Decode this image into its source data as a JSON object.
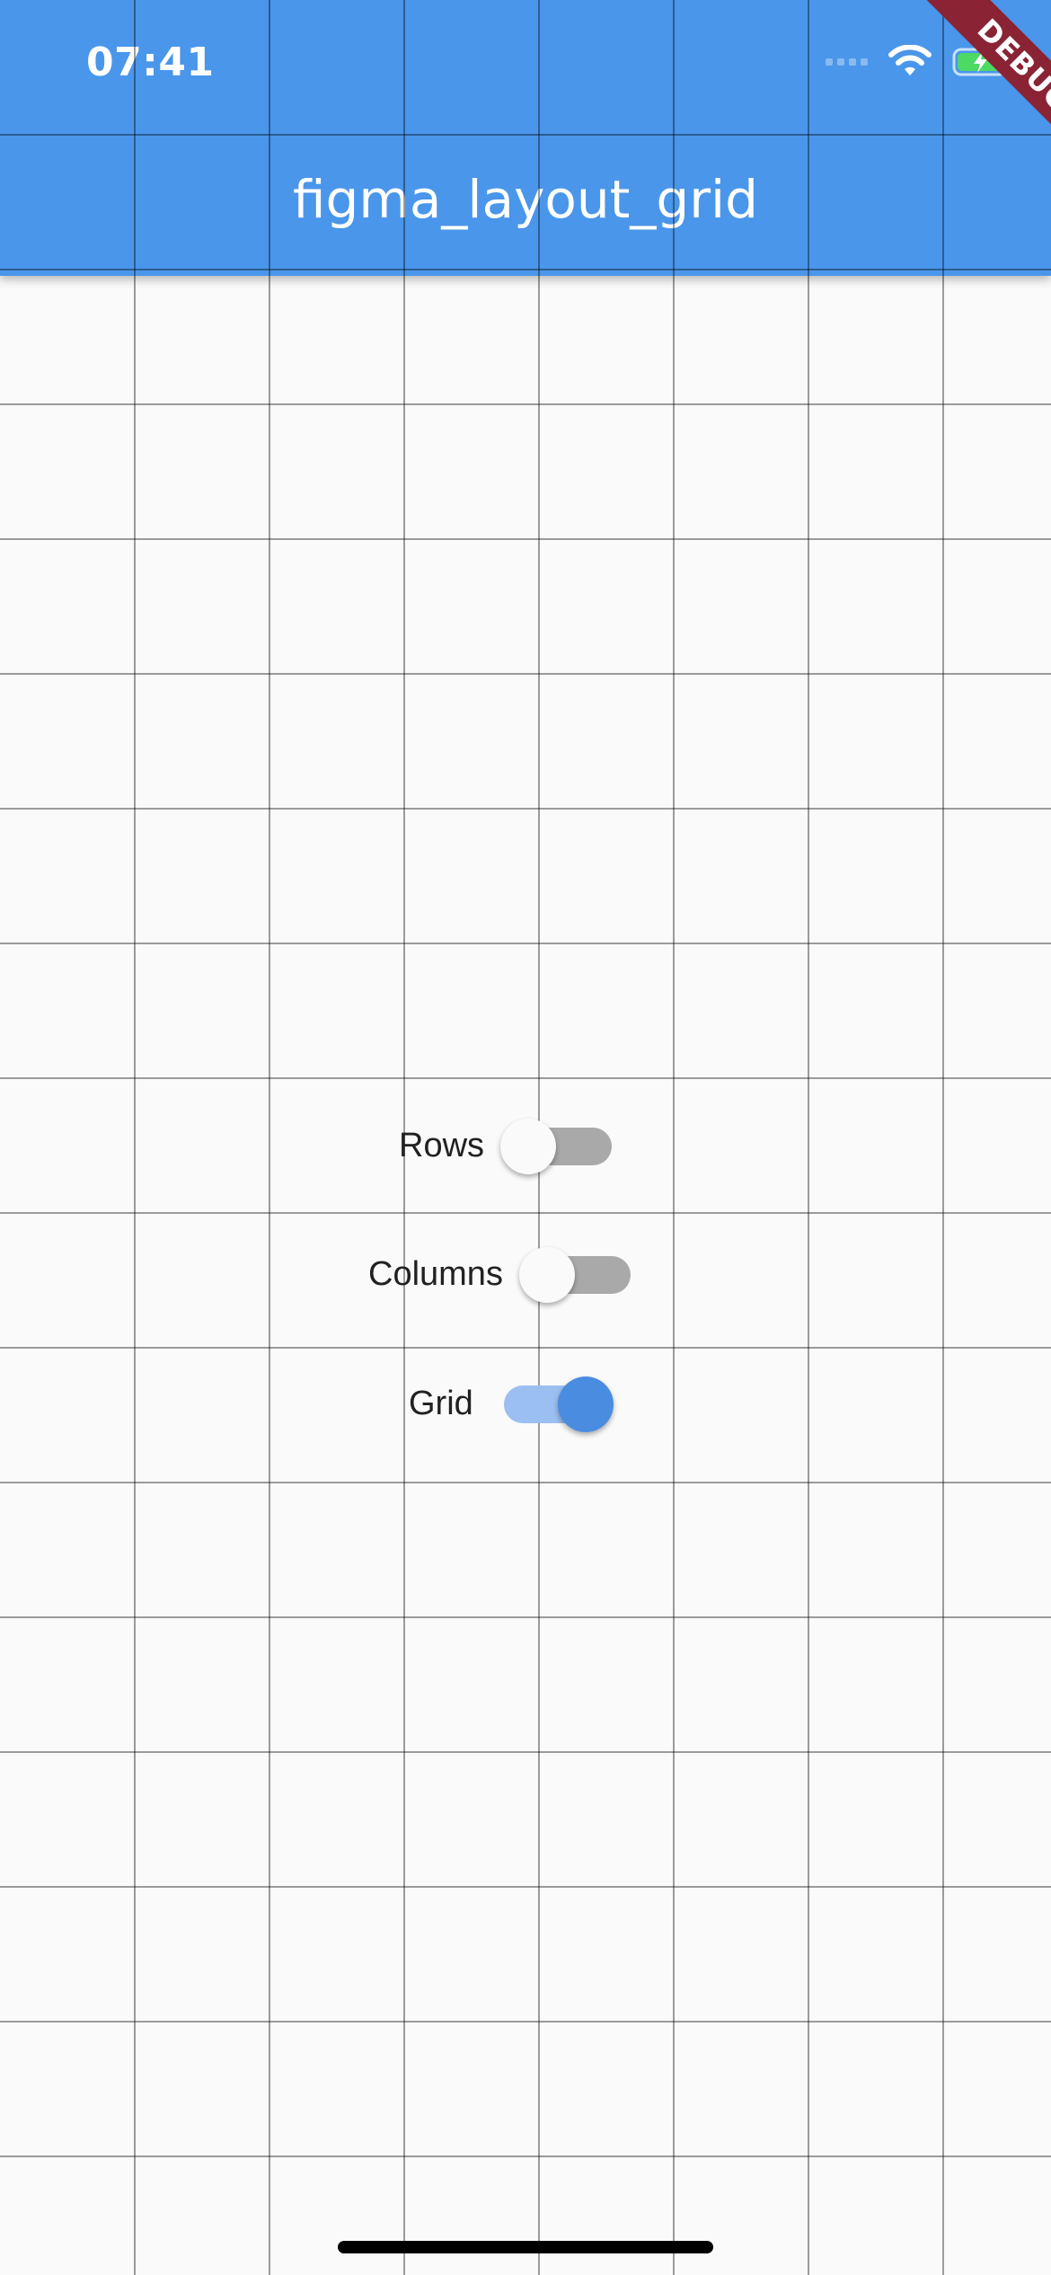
{
  "status_bar": {
    "time": "07:41",
    "icons": [
      "cellular-signal-icon",
      "wifi-icon",
      "battery-charging-icon"
    ]
  },
  "app_bar": {
    "title": "figma_layout_grid",
    "color": "#4a96ea"
  },
  "debug_banner": {
    "text": "DEBUG",
    "color": "#8a2435"
  },
  "toggles": [
    {
      "label": "Rows",
      "on": false
    },
    {
      "label": "Columns",
      "on": false
    },
    {
      "label": "Grid",
      "on": true
    }
  ],
  "colors": {
    "background": "#fafafa",
    "switch_active": "#4a8de0",
    "switch_inactive_track": "#a9a9a9"
  }
}
